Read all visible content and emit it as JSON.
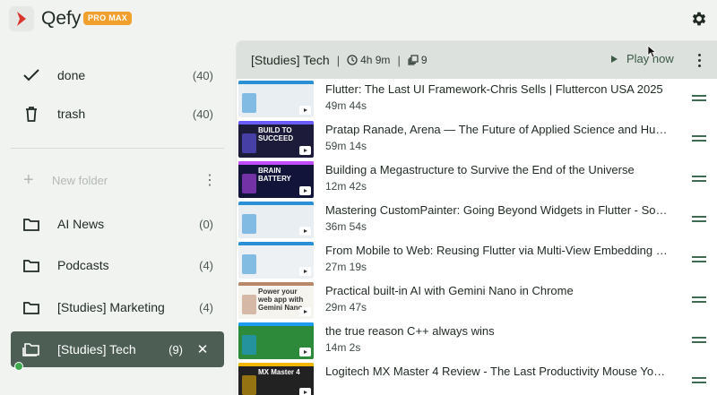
{
  "app": {
    "name": "Qefy",
    "badge": "PRO MAX"
  },
  "sidebar": {
    "system": [
      {
        "label": "done",
        "count": "(40)",
        "icon": "check-icon"
      },
      {
        "label": "trash",
        "count": "(40)",
        "icon": "trash-icon"
      }
    ],
    "new_folder": "New folder",
    "folders": [
      {
        "label": "AI News",
        "count": "(0)"
      },
      {
        "label": "Podcasts",
        "count": "(4)"
      },
      {
        "label": "[Studies] Marketing",
        "count": "(4)"
      },
      {
        "label": "[Studies] Tech",
        "count": "(9)",
        "active": true
      }
    ]
  },
  "queue": {
    "title": "[Studies] Tech",
    "duration": "4h 9m",
    "count": "9",
    "play_label": "Play now",
    "items": [
      {
        "title": "Flutter: The Last UI Framework-Chris Sells | Fluttercon USA 2025",
        "duration": "49m 44s"
      },
      {
        "title": "Pratap Ranade, Arena — The Future of Applied Science and Hu…",
        "duration": "59m 14s"
      },
      {
        "title": "Building a Megastructure to Survive the End of the Universe",
        "duration": "12m 42s"
      },
      {
        "title": "Mastering CustomPainter: Going Beyond Widgets in Flutter - So…",
        "duration": "36m 54s"
      },
      {
        "title": "From Mobile to Web: Reusing Flutter via Multi-View Embedding …",
        "duration": "27m 19s"
      },
      {
        "title": "Practical built-in AI with Gemini Nano in Chrome",
        "duration": "29m 47s"
      },
      {
        "title": "the true reason C++ always wins",
        "duration": "14m 2s"
      },
      {
        "title": "Logitech MX Master 4 Review - The Last Productivity Mouse Yo…",
        "duration": ""
      }
    ]
  },
  "thumbs": [
    {
      "text": "",
      "bg": "#e9eef2",
      "accent": "#2b8fd6"
    },
    {
      "text": "BUILD TO SUCCEED",
      "bg": "#1c1c3a",
      "accent": "#6a5cff"
    },
    {
      "text": "BRAIN BATTERY",
      "bg": "#12143a",
      "accent": "#c24dff"
    },
    {
      "text": "",
      "bg": "#e9eef2",
      "accent": "#2b8fd6"
    },
    {
      "text": "",
      "bg": "#eef1f4",
      "accent": "#2b8fd6"
    },
    {
      "text": "Power your web app with Gemini Nano",
      "bg": "#f6f4ef",
      "accent": "#b9876a"
    },
    {
      "text": "",
      "bg": "#2d8a3a",
      "accent": "#1d9bf0"
    },
    {
      "text": "MX Master 4",
      "bg": "#222222",
      "accent": "#f2b705"
    }
  ]
}
